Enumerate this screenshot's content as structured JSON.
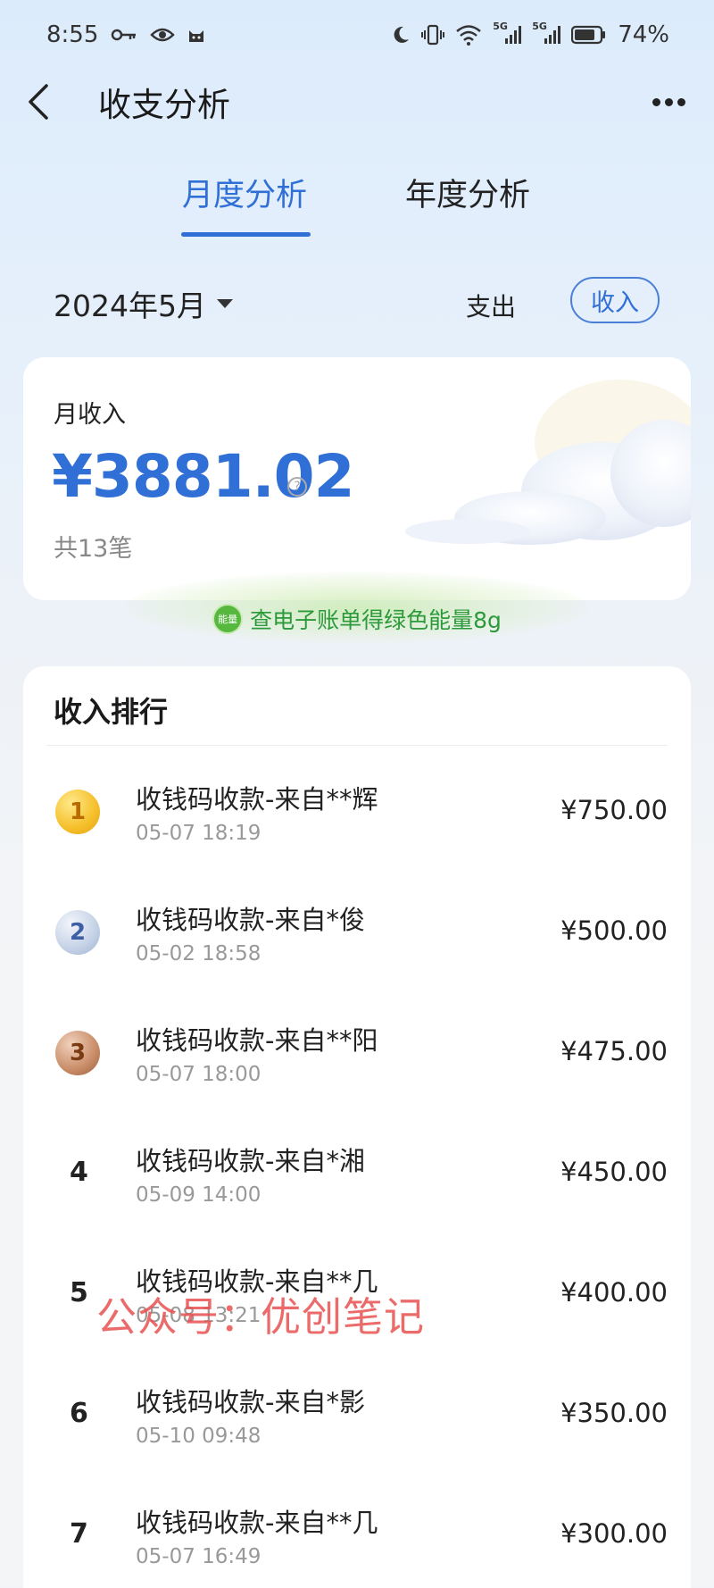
{
  "status_bar": {
    "time": "8:55",
    "battery_percent": "74%",
    "net_label_1": "5G",
    "net_label_2": "5G"
  },
  "header": {
    "title": "收支分析"
  },
  "tabs": [
    {
      "label": "月度分析",
      "active": true
    },
    {
      "label": "年度分析",
      "active": false
    }
  ],
  "filter": {
    "month": "2024年5月",
    "expense_label": "支出",
    "income_label": "收入"
  },
  "summary": {
    "label": "月收入",
    "amount": "¥3881.02",
    "help_glyph": "?",
    "count": "共13笔"
  },
  "energy": {
    "badge": "能量",
    "text": "查电子账单得绿色能量8g"
  },
  "ranking": {
    "title": "收入排行",
    "items": [
      {
        "rank": "1",
        "title": "收钱码收款-来自**辉",
        "time": "05-07 18:19",
        "amount": "¥750.00"
      },
      {
        "rank": "2",
        "title": "收钱码收款-来自*俊",
        "time": "05-02 18:58",
        "amount": "¥500.00"
      },
      {
        "rank": "3",
        "title": "收钱码收款-来自**阳",
        "time": "05-07 18:00",
        "amount": "¥475.00"
      },
      {
        "rank": "4",
        "title": "收钱码收款-来自*湘",
        "time": "05-09 14:00",
        "amount": "¥450.00"
      },
      {
        "rank": "5",
        "title": "收钱码收款-来自**几",
        "time": "05-08 13:21",
        "amount": "¥400.00"
      },
      {
        "rank": "6",
        "title": "收钱码收款-来自*影",
        "time": "05-10 09:48",
        "amount": "¥350.00"
      },
      {
        "rank": "7",
        "title": "收钱码收款-来自**几",
        "time": "05-07 16:49",
        "amount": "¥300.00"
      }
    ]
  },
  "watermark": "公众号：优创笔记",
  "colors": {
    "accent": "#2f6fd6",
    "energy_green": "#2c9a3a",
    "watermark_red": "#e85050"
  }
}
